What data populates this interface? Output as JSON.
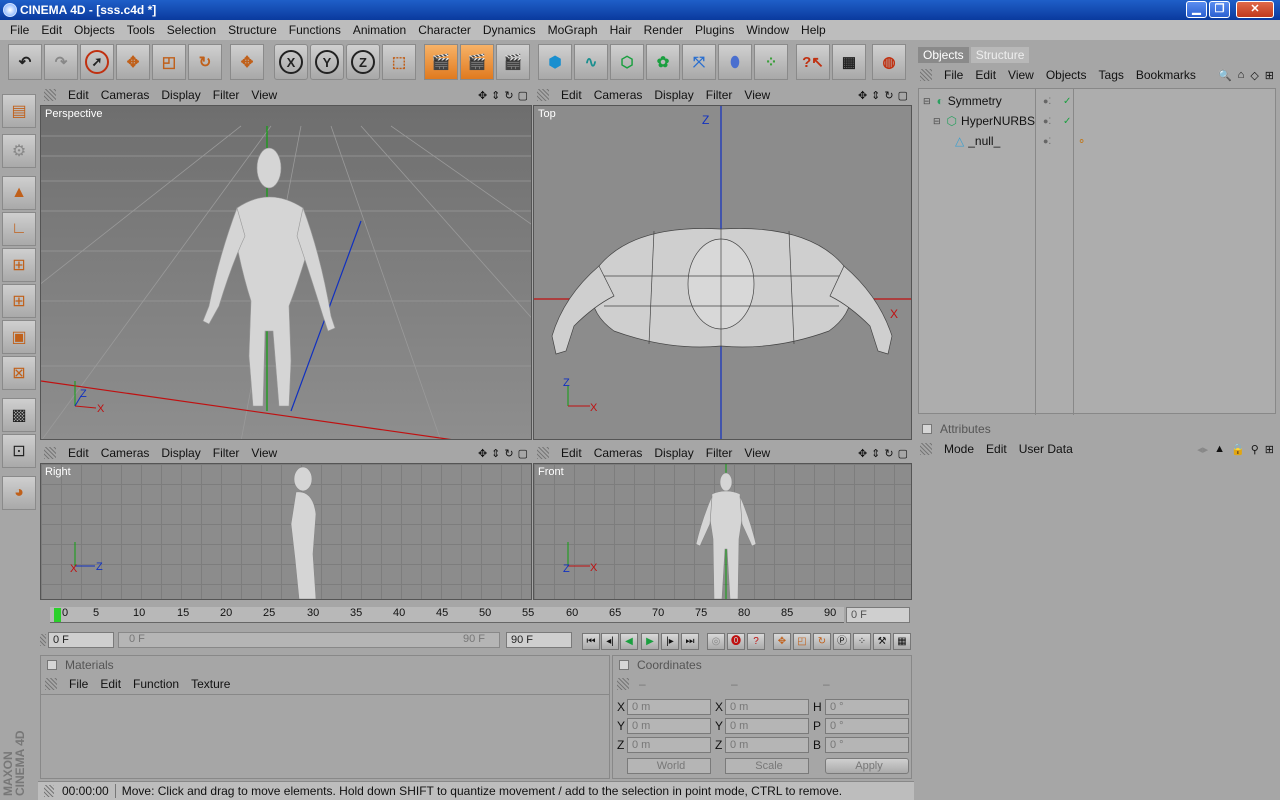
{
  "window": {
    "title": "CINEMA 4D - [sss.c4d *]",
    "min": "▁",
    "max": "❐",
    "close": "✕"
  },
  "menu": [
    "File",
    "Edit",
    "Objects",
    "Tools",
    "Selection",
    "Structure",
    "Functions",
    "Animation",
    "Character",
    "Dynamics",
    "MoGraph",
    "Hair",
    "Render",
    "Plugins",
    "Window",
    "Help"
  ],
  "toolbar": {
    "x": "X",
    "y": "Y",
    "z": "Z"
  },
  "viewport_menu": [
    "Edit",
    "Cameras",
    "Display",
    "Filter",
    "View"
  ],
  "viewports": {
    "perspective": "Perspective",
    "top": "Top",
    "right": "Right",
    "front": "Front"
  },
  "objects_panel": {
    "tabs": [
      "Objects",
      "Structure"
    ],
    "menu": [
      "File",
      "Edit",
      "View",
      "Objects",
      "Tags",
      "Bookmarks"
    ],
    "items": [
      "Symmetry",
      "HyperNURBS",
      "_null_"
    ]
  },
  "attributes_panel": {
    "title": "Attributes",
    "menu": [
      "Mode",
      "Edit",
      "User Data"
    ]
  },
  "timeline": {
    "ticks": [
      "0",
      "5",
      "10",
      "15",
      "20",
      "25",
      "30",
      "35",
      "40",
      "45",
      "50",
      "55",
      "60",
      "65",
      "70",
      "75",
      "80",
      "85",
      "90"
    ],
    "current": "0 F",
    "start": "0 F",
    "range_start": "0 F",
    "range_end": "90 F",
    "end": "90 F"
  },
  "materials_panel": {
    "title": "Materials",
    "menu": [
      "File",
      "Edit",
      "Function",
      "Texture"
    ]
  },
  "coordinates_panel": {
    "title": "Coordinates",
    "dash1": "–",
    "dash2": "–",
    "dash3": "–",
    "pos_labels": [
      "X",
      "Y",
      "Z"
    ],
    "size_labels": [
      "X",
      "Y",
      "Z"
    ],
    "rot_labels": [
      "H",
      "P",
      "B"
    ],
    "pos_values": [
      "0 m",
      "0 m",
      "0 m"
    ],
    "size_values": [
      "0 m",
      "0 m",
      "0 m"
    ],
    "rot_values": [
      "0 °",
      "0 °",
      "0 °"
    ],
    "world": "World",
    "scale": "Scale",
    "apply": "Apply"
  },
  "status": {
    "time": "00:00:00",
    "message": "Move: Click and drag to move elements. Hold down SHIFT to quantize movement / add to the selection in point mode, CTRL to remove."
  },
  "branding": {
    "line1": "MAXON",
    "line2": "CINEMA 4D"
  },
  "axis_labels": {
    "z": "Z",
    "x": "X"
  },
  "colors": {
    "accent": "#e07a1f",
    "viewport_bg": "#8c8c8c",
    "title_blue": "#0a3a9e",
    "axis_red": "#c01010",
    "axis_blue": "#1030c0",
    "axis_green": "#10a010"
  }
}
